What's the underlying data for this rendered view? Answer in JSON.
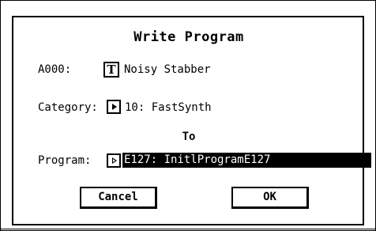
{
  "dialog": {
    "title": "Write Program",
    "source": {
      "label": "A000:",
      "type_icon": "T",
      "name": "Noisy Stabber"
    },
    "category": {
      "label": "Category:",
      "value": "10: FastSynth"
    },
    "to_label": "To",
    "program": {
      "label": "Program:",
      "value": "E127: InitlProgramE127"
    },
    "buttons": {
      "cancel": "Cancel",
      "ok": "OK"
    }
  }
}
